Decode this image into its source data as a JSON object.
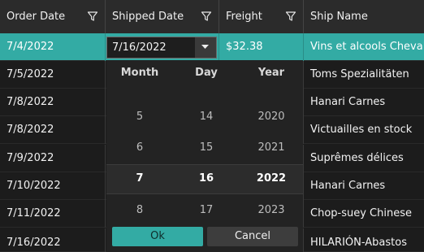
{
  "columns": [
    {
      "label": "Order Date"
    },
    {
      "label": "Shipped Date"
    },
    {
      "label": "Freight"
    },
    {
      "label": "Ship Name"
    }
  ],
  "rows": [
    {
      "order_date": "7/4/2022",
      "shipped_date": "",
      "freight": "$32.38",
      "ship_name": "Vins et alcools Chevalier"
    },
    {
      "order_date": "7/5/2022",
      "shipped_date": "",
      "freight": "",
      "ship_name": "Toms Spezialitäten"
    },
    {
      "order_date": "7/8/2022",
      "shipped_date": "",
      "freight": "",
      "ship_name": "Hanari Carnes"
    },
    {
      "order_date": "7/8/2022",
      "shipped_date": "",
      "freight": "",
      "ship_name": "Victuailles en stock"
    },
    {
      "order_date": "7/9/2022",
      "shipped_date": "",
      "freight": "",
      "ship_name": "Suprêmes délices"
    },
    {
      "order_date": "7/10/2022",
      "shipped_date": "",
      "freight": "",
      "ship_name": "Hanari Carnes"
    },
    {
      "order_date": "7/11/2022",
      "shipped_date": "",
      "freight": "",
      "ship_name": "Chop-suey Chinese"
    },
    {
      "order_date": "7/16/2022",
      "shipped_date": "",
      "freight": "",
      "ship_name": "HILARIÓN-Abastos"
    }
  ],
  "editor": {
    "value": "7/16/2022"
  },
  "picker": {
    "headers": {
      "month": "Month",
      "day": "Day",
      "year": "Year"
    },
    "month_values": [
      "5",
      "6",
      "7",
      "8"
    ],
    "day_values": [
      "14",
      "15",
      "16",
      "17"
    ],
    "year_values": [
      "2020",
      "2021",
      "2022",
      "2023"
    ],
    "selected_index": 2,
    "ok_label": "Ok",
    "cancel_label": "Cancel"
  },
  "colors": {
    "accent": "#33aba4",
    "background": "#1c1c1c",
    "header": "#2b2b2b"
  },
  "icons": {
    "filter": "filter-icon",
    "dropdown": "chevron-down-icon"
  }
}
